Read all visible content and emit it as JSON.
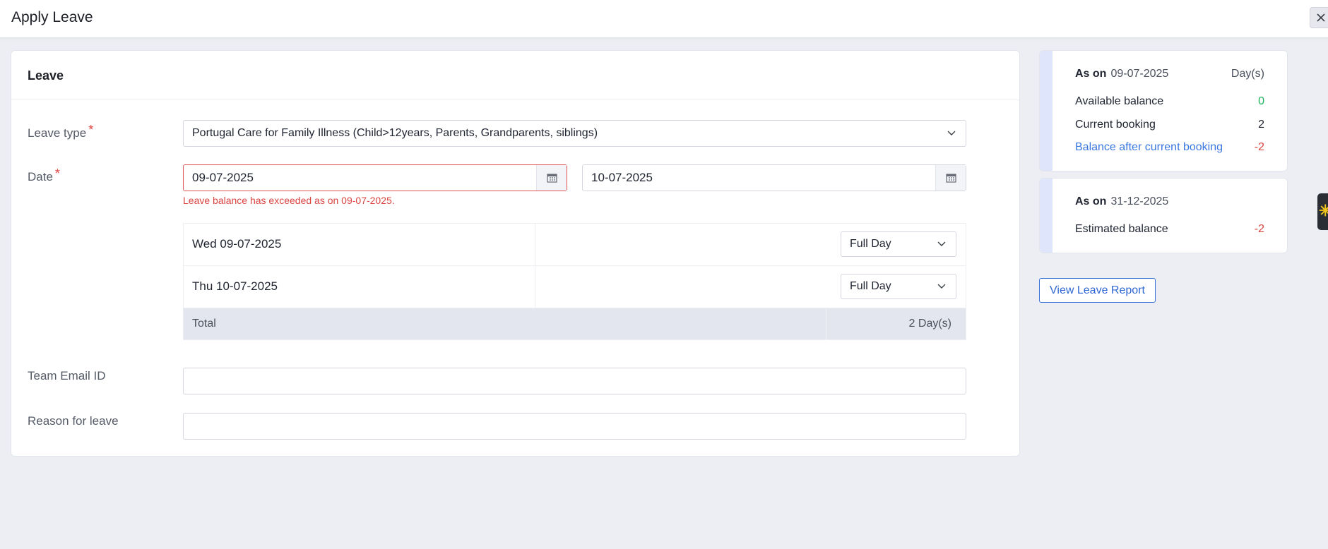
{
  "header": {
    "title": "Apply Leave"
  },
  "form": {
    "section_title": "Leave",
    "leave_type": {
      "label": "Leave type",
      "required_mark": "*",
      "value": "Portugal Care for Family Illness (Child>12years, Parents, Grandparents, siblings)"
    },
    "date": {
      "label": "Date",
      "required_mark": "*",
      "from": "09-07-2025",
      "to": "10-07-2025",
      "error": "Leave balance has exceeded as on 09-07-2025."
    },
    "days": [
      {
        "label": "Wed 09-07-2025",
        "session": "Full Day"
      },
      {
        "label": "Thu 10-07-2025",
        "session": "Full Day"
      }
    ],
    "total": {
      "label": "Total",
      "value": "2 Day(s)"
    },
    "team_email": {
      "label": "Team Email ID",
      "value": ""
    },
    "reason": {
      "label": "Reason for leave",
      "value": ""
    }
  },
  "balance_card": {
    "as_on_label": "As on",
    "as_on_date": "09-07-2025",
    "unit": "Day(s)",
    "rows": [
      {
        "label": "Available balance",
        "value": "0"
      },
      {
        "label": "Current booking",
        "value": "2"
      },
      {
        "label": "Balance after current booking",
        "value": "-2"
      }
    ]
  },
  "estimate_card": {
    "as_on_label": "As on",
    "as_on_date": "31-12-2025",
    "label": "Estimated balance",
    "value": "-2"
  },
  "actions": {
    "view_report": "View Leave Report"
  },
  "colors": {
    "error": "#d9443f",
    "positive": "#1bb35a",
    "link": "#3b77e0",
    "accent": "#dfe6fb",
    "total_row": "#e4e6ef"
  },
  "icons": [
    "close-icon",
    "chevron-down-icon",
    "calendar-icon",
    "sparkle-icon"
  ]
}
